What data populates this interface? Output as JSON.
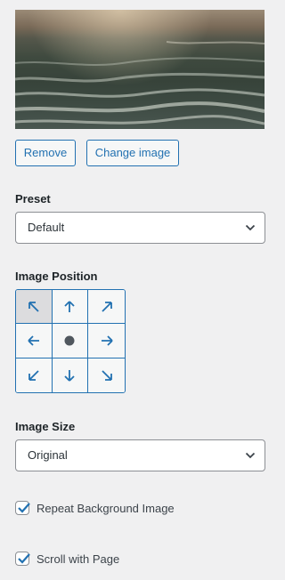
{
  "image_preview": {
    "alt": "Ocean waves background image"
  },
  "buttons": {
    "remove": "Remove",
    "change_image": "Change image"
  },
  "preset": {
    "label": "Preset",
    "value": "Default"
  },
  "image_position": {
    "label": "Image Position",
    "selected": "top-left",
    "cells": [
      {
        "id": "top-left",
        "icon": "arrow-up-left-icon"
      },
      {
        "id": "top",
        "icon": "arrow-up-icon"
      },
      {
        "id": "top-right",
        "icon": "arrow-up-right-icon"
      },
      {
        "id": "left",
        "icon": "arrow-left-icon"
      },
      {
        "id": "center",
        "icon": "dot-icon"
      },
      {
        "id": "right",
        "icon": "arrow-right-icon"
      },
      {
        "id": "bottom-left",
        "icon": "arrow-down-left-icon"
      },
      {
        "id": "bottom",
        "icon": "arrow-down-icon"
      },
      {
        "id": "bottom-right",
        "icon": "arrow-down-right-icon"
      }
    ]
  },
  "image_size": {
    "label": "Image Size",
    "value": "Original"
  },
  "options": {
    "repeat": {
      "label": "Repeat Background Image",
      "checked": true
    },
    "scroll": {
      "label": "Scroll with Page",
      "checked": true
    }
  },
  "colors": {
    "accent": "#2271b1",
    "background": "#f0f0f1",
    "text": "#1d2327",
    "dot": "#50575e"
  }
}
